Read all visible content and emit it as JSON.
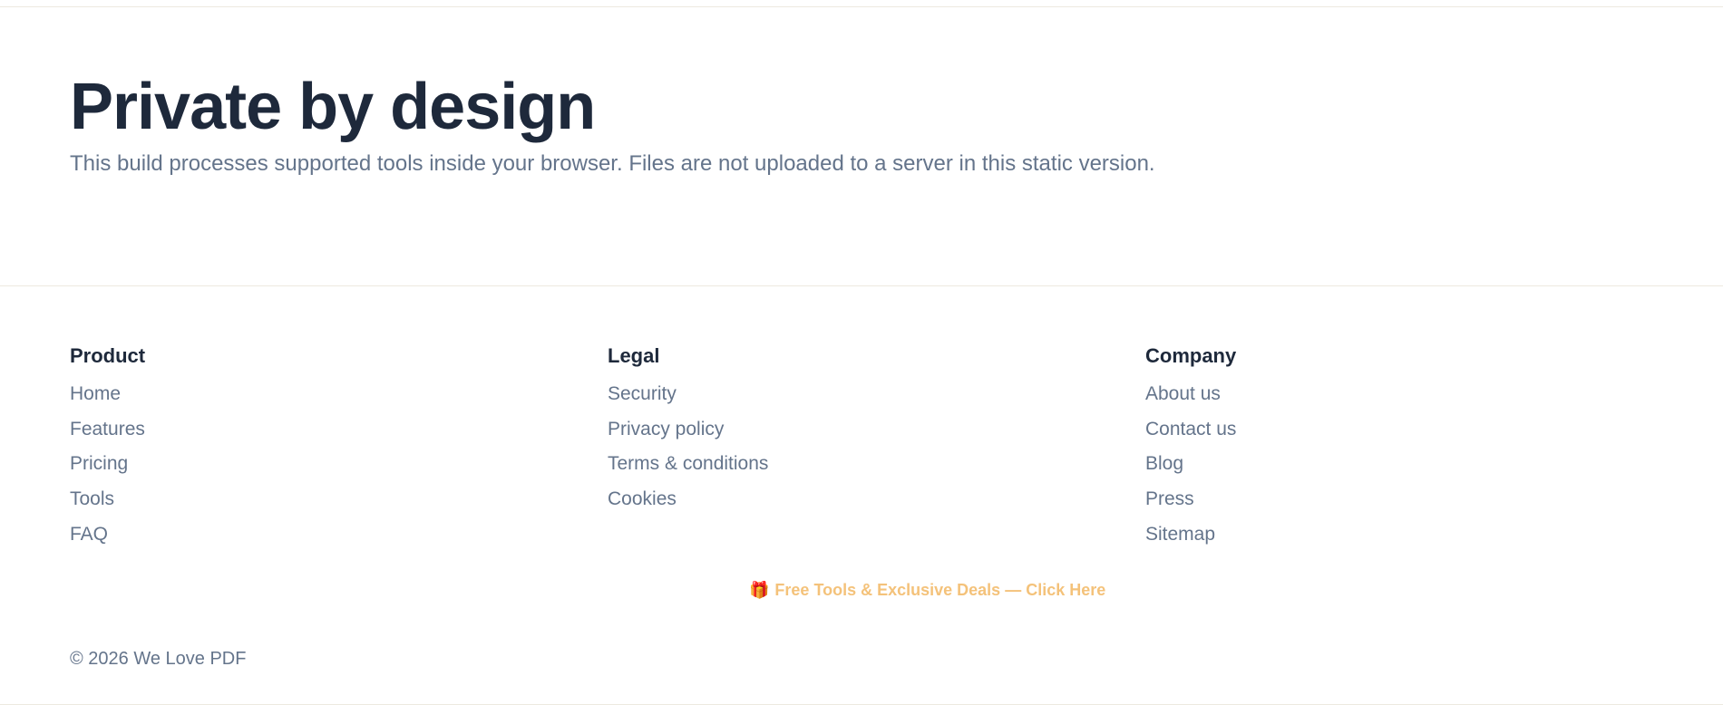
{
  "hero": {
    "title": "Private by design",
    "subtitle": "This build processes supported tools inside your browser. Files are not uploaded to a server in this static version."
  },
  "footer": {
    "columns": [
      {
        "title": "Product",
        "links": [
          "Home",
          "Features",
          "Pricing",
          "Tools",
          "FAQ"
        ]
      },
      {
        "title": "Legal",
        "links": [
          "Security",
          "Privacy policy",
          "Terms & conditions",
          "Cookies"
        ]
      },
      {
        "title": "Company",
        "links": [
          "About us",
          "Contact us",
          "Blog",
          "Press",
          "Sitemap"
        ]
      }
    ],
    "promo": {
      "icon": "gift-icon",
      "glyph": "🎁",
      "label": "Free Tools & Exclusive Deals — Click Here"
    },
    "copyright": "© 2026 We Love PDF"
  },
  "colors": {
    "heading": "#1e293b",
    "muted_text": "#64748b",
    "promo": "#f4c27a",
    "rule": "#ede9e0"
  }
}
